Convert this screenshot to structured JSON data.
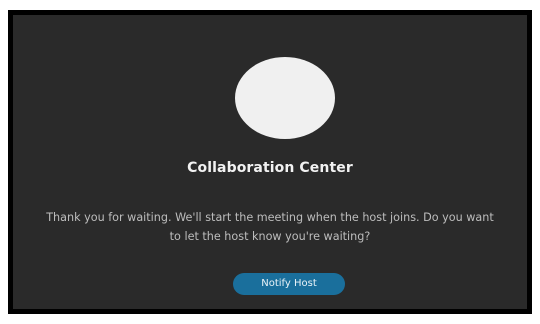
{
  "dialog": {
    "title": "Collaboration Center",
    "message": "Thank you for waiting. We'll start the meeting when the host joins. Do you want to let the host know you're waiting?",
    "notify_button_label": "Notify Host"
  },
  "colors": {
    "background": "#2a2a2a",
    "frame": "#000000",
    "avatar": "#f0f0f0",
    "button": "#1a6f9c"
  }
}
